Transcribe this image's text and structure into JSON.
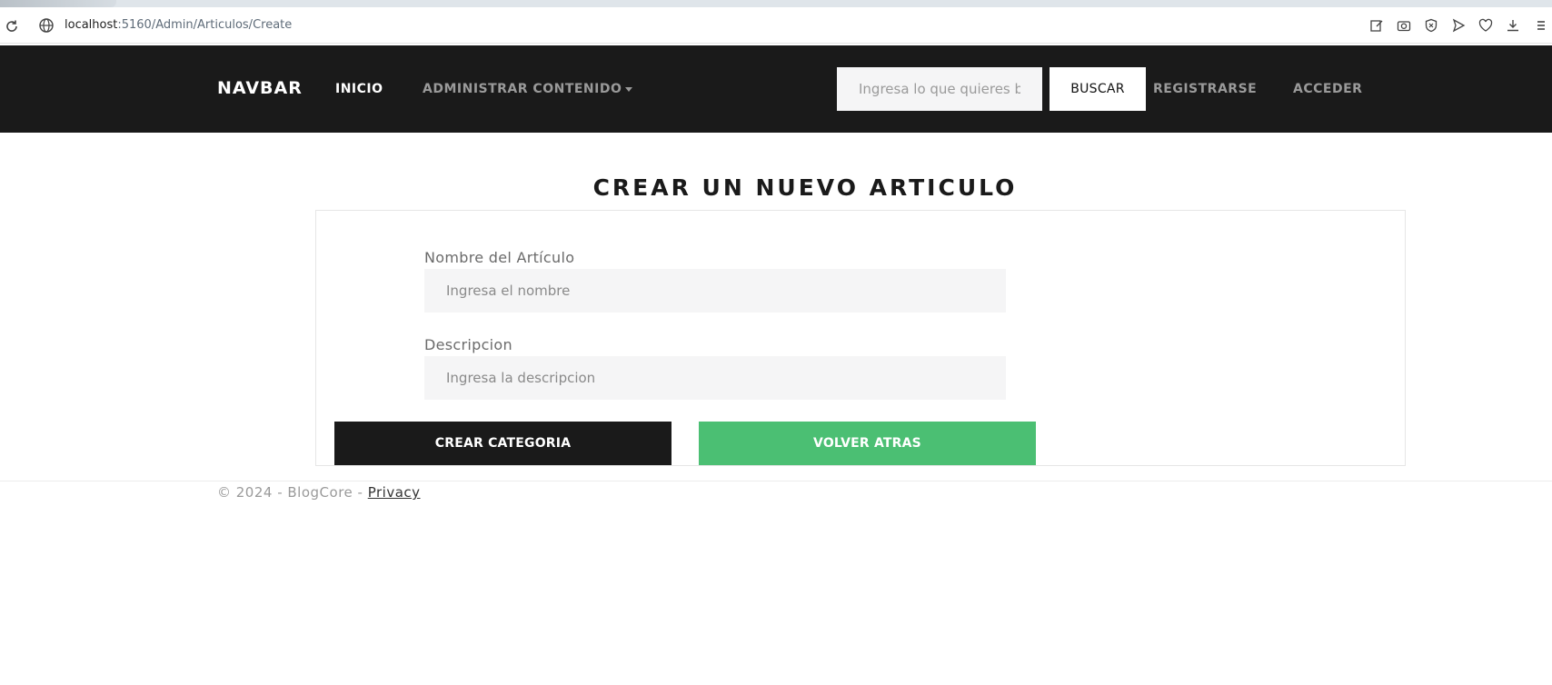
{
  "browser": {
    "url_host": "localhost",
    "url_path": ":5160/Admin/Articulos/Create",
    "icons": [
      "reload-icon",
      "site-info-icon",
      "edit-icon",
      "camera-icon",
      "shield-icon",
      "send-icon",
      "heart-icon",
      "download-icon",
      "menu-icon"
    ]
  },
  "navbar": {
    "brand": "NAVBAR",
    "links": {
      "home": "INICIO",
      "admin": "ADMINISTRAR CONTENIDO",
      "register": "REGISTRARSE",
      "login": "ACCEDER"
    },
    "search": {
      "placeholder": "Ingresa lo que quieres buscar",
      "button_label": "BUSCAR"
    }
  },
  "main": {
    "title": "CREAR UN NUEVO ARTICULO",
    "form": {
      "name_label": "Nombre del Artículo",
      "name_placeholder": "Ingresa el nombre",
      "description_label": "Descripcion",
      "description_placeholder": "Ingresa la descripcion",
      "create_button": "CREAR CATEGORIA",
      "back_button": "VOLVER ATRAS"
    }
  },
  "footer": {
    "text": "© 2024 - BlogCore - ",
    "privacy_link": "Privacy"
  },
  "colors": {
    "navbar_bg": "#1a1a1a",
    "accent_green": "#4bbf73",
    "input_bg": "#f5f5f6"
  }
}
